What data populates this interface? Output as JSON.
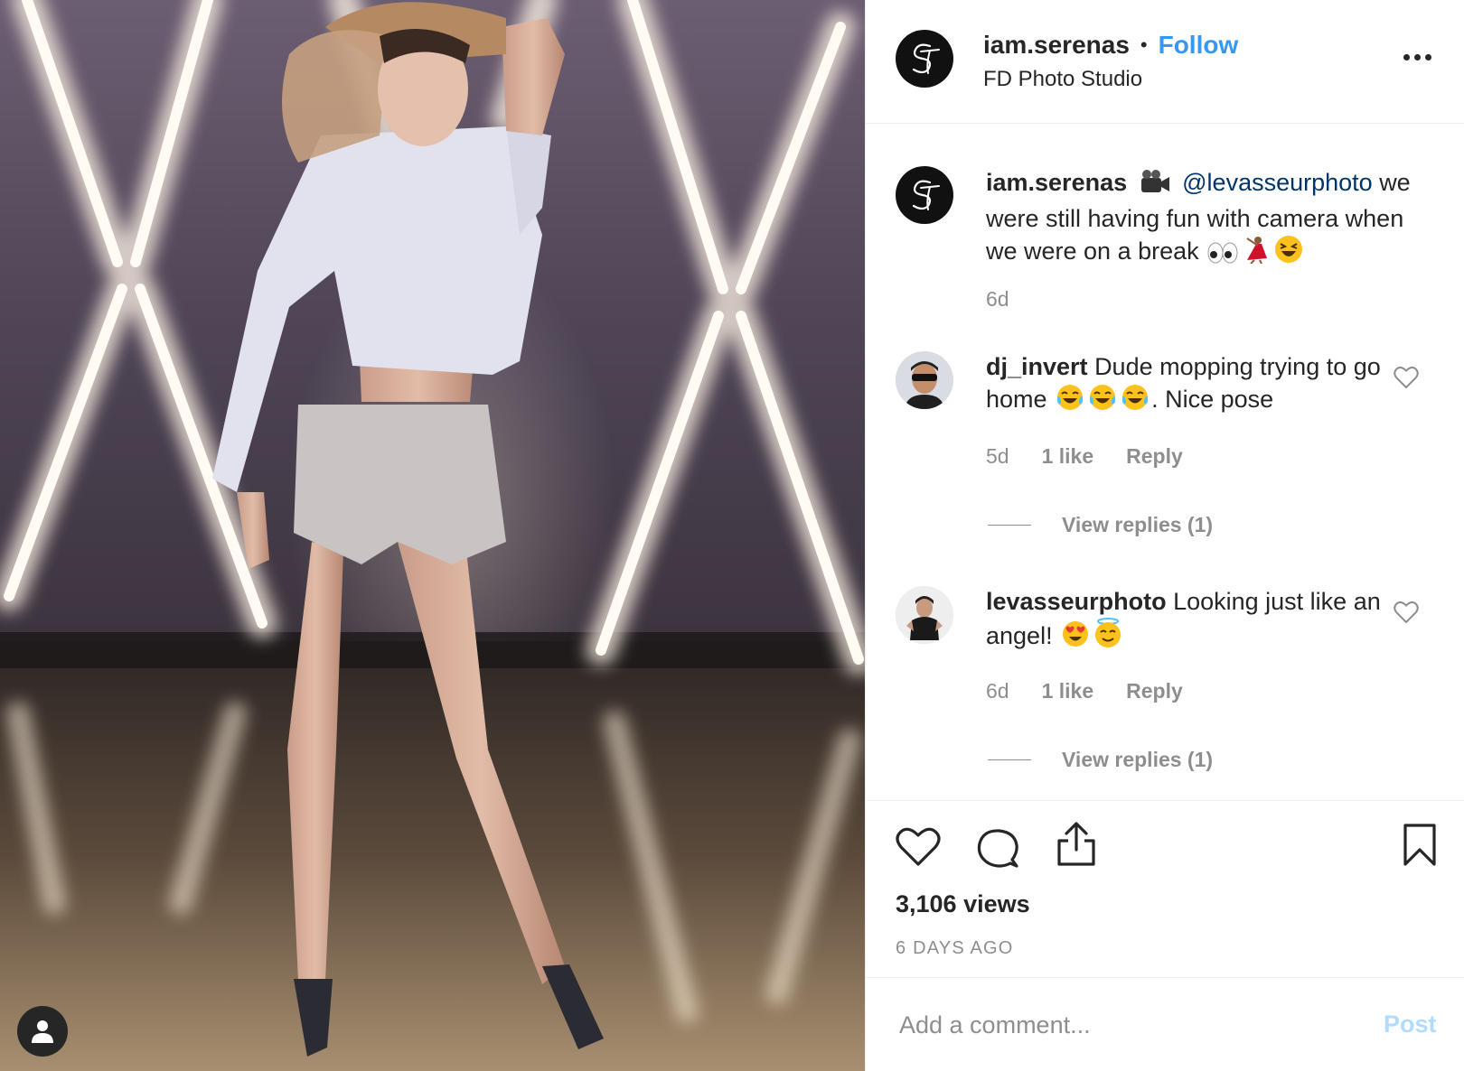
{
  "post": {
    "username": "iam.serenas",
    "separator": "•",
    "follow_label": "Follow",
    "location": "FD Photo Studio",
    "more_options_icon": "more-horizontal-icon",
    "avatar_monogram": "ST"
  },
  "caption": {
    "username": "iam.serenas",
    "video_camera_icon": "video-camera-icon",
    "mention": "@levasseurphoto",
    "text": "we were still having fun with camera when we were on a break",
    "emojis": [
      "eyes-emoji",
      "dancer-emoji",
      "grinning-squinting-emoji"
    ],
    "time": "6d"
  },
  "comments": [
    {
      "username": "dj_invert",
      "text_part1": "Dude mopping trying to go home",
      "emojis": [
        "tears-of-joy-emoji",
        "tears-of-joy-emoji",
        "tears-of-joy-emoji"
      ],
      "text_part2": ". Nice pose",
      "time": "5d",
      "likes": "1 like",
      "reply_label": "Reply",
      "view_replies": "View replies (1)"
    },
    {
      "username": "levasseurphoto",
      "text_part1": "Looking just like an angel!",
      "emojis": [
        "heart-eyes-emoji",
        "halo-emoji"
      ],
      "time": "6d",
      "likes": "1 like",
      "reply_label": "Reply",
      "view_replies": "View replies (1)"
    }
  ],
  "stats": {
    "views": "3,106 views",
    "posted_ago": "6 DAYS AGO"
  },
  "add_comment": {
    "placeholder": "Add a comment...",
    "post_label": "Post"
  },
  "colors": {
    "link_blue": "#3897f0",
    "mention_blue": "#003569",
    "muted_gray": "#8e8e8e",
    "post_disabled": "#b3dbff",
    "text": "#262626"
  }
}
